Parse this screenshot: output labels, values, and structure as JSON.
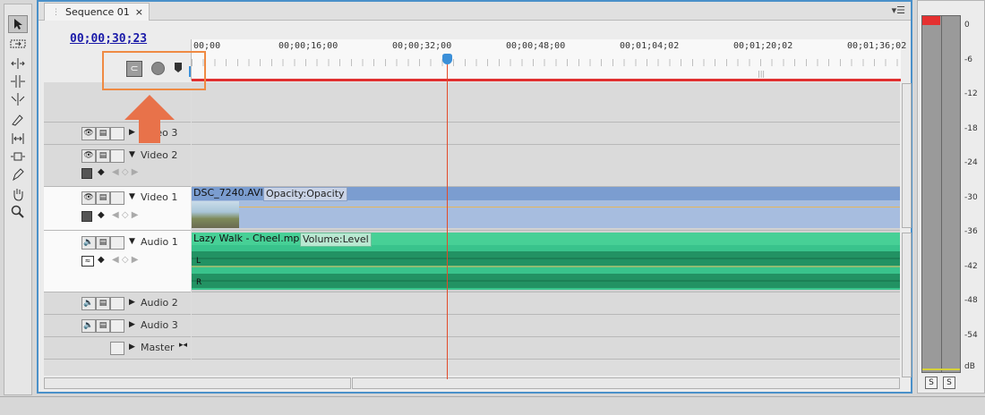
{
  "sequence_tab": {
    "label": "Sequence 01",
    "close": "×"
  },
  "timecode": "00;00;30;23",
  "ruler": {
    "labels": [
      "00;00",
      "00;00;16;00",
      "00;00;32;00",
      "00;00;48;00",
      "00;01;04;02",
      "00;01;20;02",
      "00;01;36;02"
    ]
  },
  "tracks": {
    "video3": {
      "name": "Video 3"
    },
    "video2": {
      "name": "Video 2"
    },
    "video1": {
      "name": "Video 1"
    },
    "audio1": {
      "name": "Audio 1"
    },
    "audio2": {
      "name": "Audio 2"
    },
    "audio3": {
      "name": "Audio 3"
    },
    "master": {
      "name": "Master"
    }
  },
  "clips": {
    "video": {
      "name": "DSC_7240.AVI",
      "effect": "Opacity:Opacity"
    },
    "audio": {
      "name": "Lazy Walk - Cheel.mp3",
      "effect": "Volume:Level",
      "left": "L",
      "right": "R"
    }
  },
  "meter": {
    "scale": [
      "0",
      "-6",
      "-12",
      "-18",
      "-24",
      "-30",
      "-36",
      "-42",
      "-48",
      "-54",
      "dB"
    ],
    "solo_left": "S",
    "solo_right": "S",
    "colors": {
      "peak": "#e53030",
      "level": "#9a9a9a"
    }
  },
  "colors": {
    "accent": "#4a90c9",
    "playhead": "#e24a2a",
    "highlight": "#ef8a43",
    "video_clip": "#7b9dd0",
    "audio_clip": "#39c38c"
  },
  "icons": [
    "selection-tool-icon",
    "track-select-tool-icon",
    "ripple-edit-tool-icon",
    "rolling-edit-tool-icon",
    "rate-stretch-tool-icon",
    "razor-tool-icon",
    "slip-tool-icon",
    "slide-tool-icon",
    "pen-tool-icon",
    "hand-tool-icon",
    "zoom-tool-icon",
    "snap-icon",
    "set-encore-marker-icon",
    "set-marker-icon",
    "eye-icon",
    "film-icon",
    "speaker-icon",
    "keyframe-icon"
  ]
}
